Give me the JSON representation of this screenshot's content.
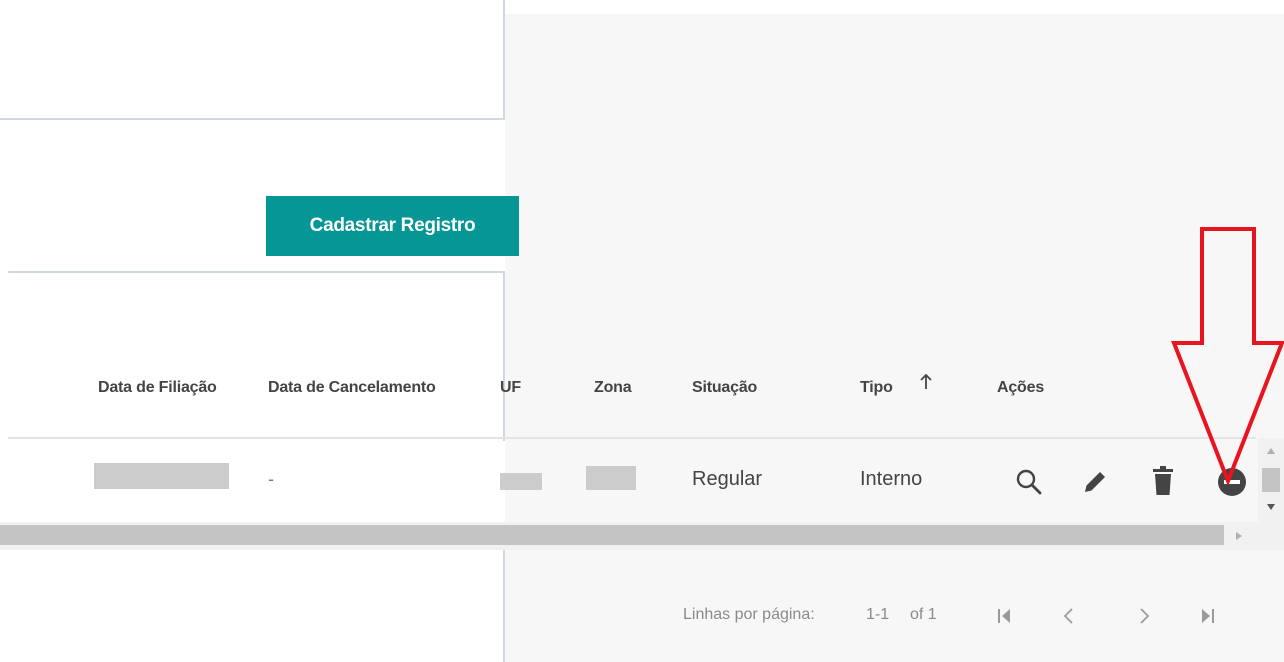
{
  "actions": {
    "register_button": "Cadastrar Registro"
  },
  "table": {
    "columns": [
      "Data de Filiação",
      "Data de Cancelamento",
      "UF",
      "Zona",
      "Situação",
      "Tipo",
      "Ações"
    ],
    "sorted_column": "Tipo",
    "sort_direction": "ascending",
    "rows": [
      {
        "data_filiacao": "",
        "data_cancelamento": "-",
        "uf": "",
        "zona": "",
        "situacao": "Regular",
        "tipo": "Interno"
      }
    ],
    "row_actions": [
      "search-icon",
      "edit-icon",
      "delete-icon",
      "remove-circle-icon"
    ]
  },
  "pagination": {
    "rows_per_page_label": "Linhas por página:",
    "range_label": "1-1",
    "of_label": "of 1"
  },
  "colors": {
    "primary": "#069696",
    "annotation_arrow": "#e8141e",
    "divider": "#cfd8e3"
  }
}
